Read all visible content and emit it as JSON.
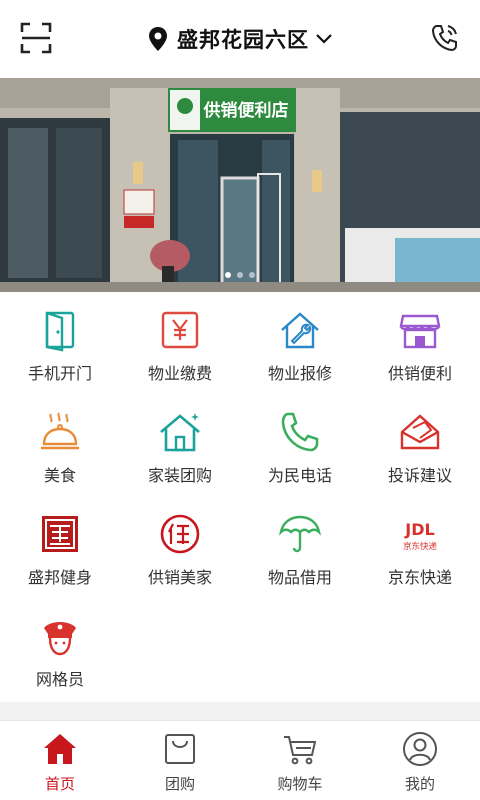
{
  "header": {
    "location": "盛邦花园六区",
    "scan_icon": "scan-icon",
    "phone_icon": "phone-icon"
  },
  "banner": {
    "store_sign": "供销便利店",
    "slide_count": 3,
    "active_slide": 1
  },
  "grid": {
    "items": [
      {
        "label": "手机开门",
        "icon": "door-icon"
      },
      {
        "label": "物业缴费",
        "icon": "yen-bill-icon"
      },
      {
        "label": "物业报修",
        "icon": "house-wrench-icon"
      },
      {
        "label": "供销便利",
        "icon": "shop-icon"
      },
      {
        "label": "美食",
        "icon": "food-cloche-icon"
      },
      {
        "label": "家装团购",
        "icon": "house-icon"
      },
      {
        "label": "为民电话",
        "icon": "phone-icon"
      },
      {
        "label": "投诉建议",
        "icon": "mail-icon"
      },
      {
        "label": "盛邦健身",
        "icon": "fitness-logo-icon"
      },
      {
        "label": "供销美家",
        "icon": "meijia-logo-icon"
      },
      {
        "label": "物品借用",
        "icon": "umbrella-icon"
      },
      {
        "label": "京东快递",
        "icon": "jdl-logo-icon"
      },
      {
        "label": "网格员",
        "icon": "police-cap-icon"
      }
    ],
    "jdl_logo_text": "JDL",
    "jdl_logo_subtext": "京东快递"
  },
  "tabbar": {
    "items": [
      {
        "label": "首页",
        "icon": "home-icon",
        "active": true
      },
      {
        "label": "团购",
        "icon": "bag-icon",
        "active": false
      },
      {
        "label": "购物车",
        "icon": "cart-icon",
        "active": false
      },
      {
        "label": "我的",
        "icon": "user-icon",
        "active": false
      }
    ]
  },
  "colors": {
    "accent": "#c8161d",
    "teal": "#1aa39a",
    "orange": "#e88c3a",
    "blue": "#2b88c8",
    "purple": "#9b59d0",
    "green": "#3aae5c",
    "red": "#d8322d"
  }
}
